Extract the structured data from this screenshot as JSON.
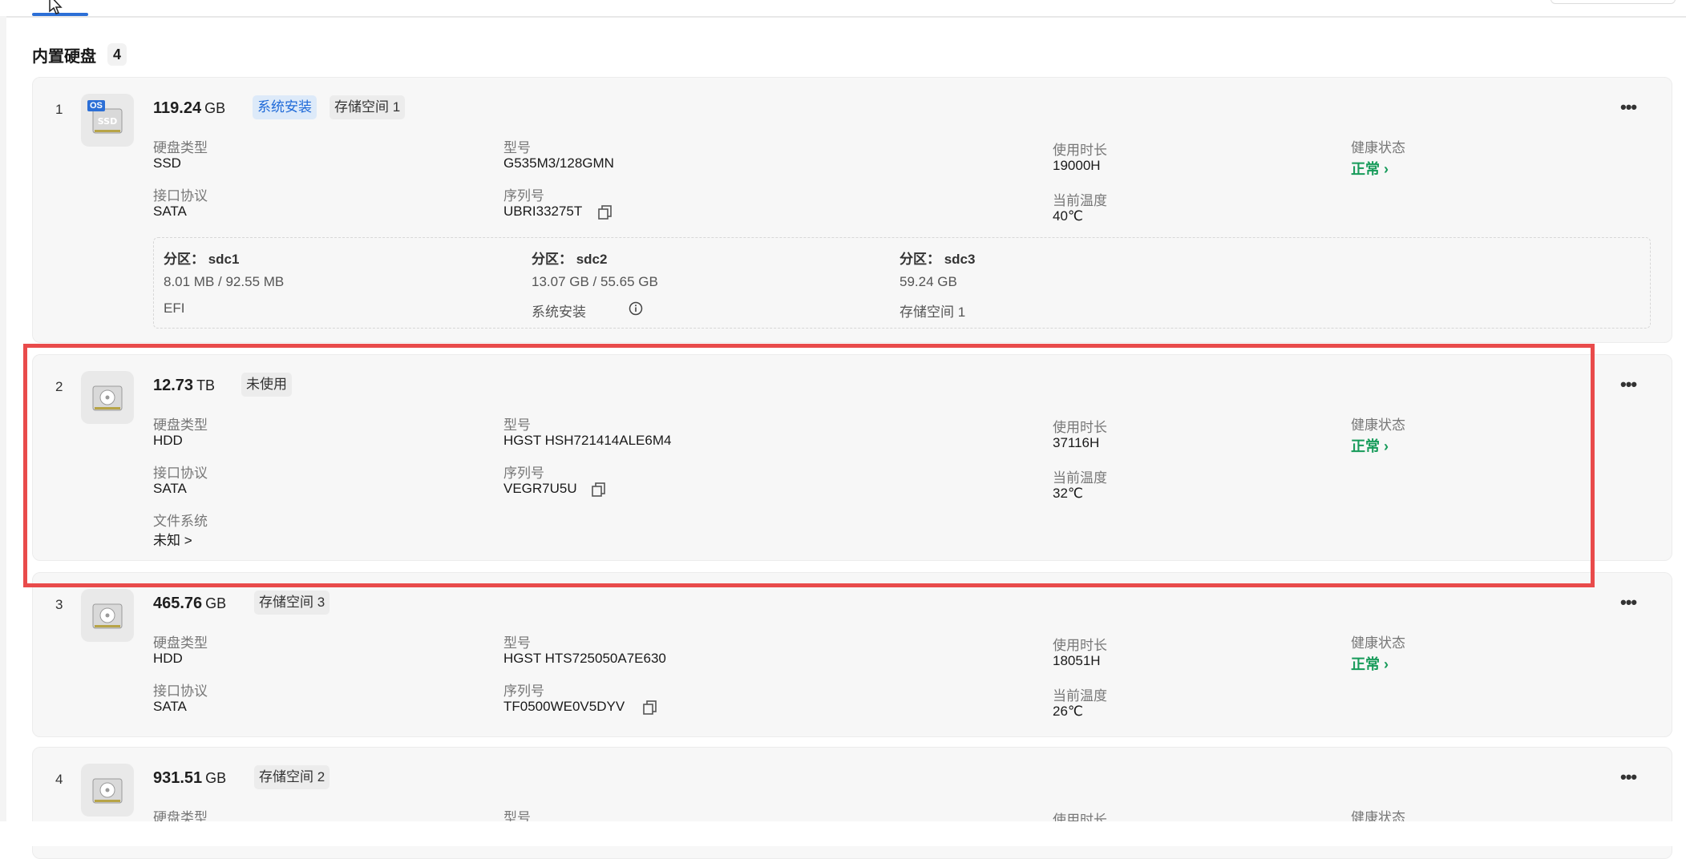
{
  "section": {
    "title": "内置硬盘",
    "count": "4"
  },
  "labels": {
    "disk_type": "硬盘类型",
    "model": "型号",
    "usage_time": "使用时长",
    "health": "健康状态",
    "interface": "接口协议",
    "serial": "序列号",
    "temperature": "当前温度",
    "filesystem": "文件系统"
  },
  "disks": [
    {
      "index": "1",
      "capacity": "119.24",
      "unit": "GB",
      "os_badge": "OS",
      "tags": [
        "系统安装",
        "存储空间 1"
      ],
      "disk_type": "SSD",
      "interface": "SATA",
      "model": "G535M3/128GMN",
      "serial": "UBRI33275T",
      "usage_time": "19000H",
      "temperature": "40℃",
      "health": "正常",
      "partitions": [
        {
          "title": "分区：  sdc1",
          "size": "8.01 MB / 92.55 MB",
          "usage": "EFI"
        },
        {
          "title": "分区：  sdc2",
          "size": "13.07 GB / 55.65 GB",
          "usage": "系统安装"
        },
        {
          "title": "分区：  sdc3",
          "size": "59.24 GB",
          "usage": "存储空间 1"
        }
      ]
    },
    {
      "index": "2",
      "capacity": "12.73",
      "unit": "TB",
      "tags": [
        "未使用"
      ],
      "disk_type": "HDD",
      "interface": "SATA",
      "model": "HGST HSH721414ALE6M4",
      "serial": "VEGR7U5U",
      "usage_time": "37116H",
      "temperature": "32℃",
      "health": "正常",
      "filesystem": "未知 >"
    },
    {
      "index": "3",
      "capacity": "465.76",
      "unit": "GB",
      "tags": [
        "存储空间 3"
      ],
      "disk_type": "HDD",
      "interface": "SATA",
      "model": "HGST HTS725050A7E630",
      "serial": "TF0500WE0V5DYV",
      "usage_time": "18051H",
      "temperature": "26℃",
      "health": "正常"
    },
    {
      "index": "4",
      "capacity": "931.51",
      "unit": "GB",
      "tags": [
        "存储空间 2"
      ]
    }
  ],
  "colors": {
    "accent": "#2c6fd6",
    "health_ok": "#179b5a",
    "highlight": "#e94b4b"
  }
}
